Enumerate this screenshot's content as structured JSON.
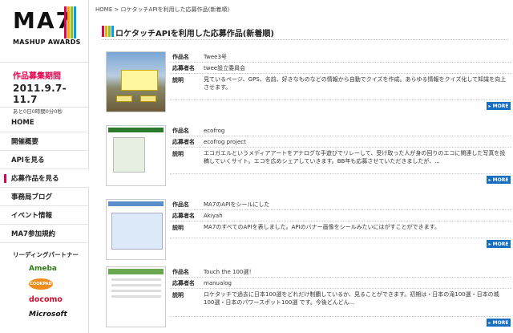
{
  "logo": {
    "text": "MA7",
    "sub": "MASHUP AWARDS"
  },
  "colors": {
    "accent": "#e5004f",
    "more_button": "#1a6ec0",
    "logo_bars": [
      "#e5004f",
      "#f7a600",
      "#8fc31f",
      "#00a0e9"
    ]
  },
  "period": {
    "title": "作品募集期間",
    "date": "2011.9.7-11.7",
    "remain": "あと0日0時間0分0秒"
  },
  "nav": {
    "items": [
      {
        "label": "HOME",
        "active": false
      },
      {
        "label": "開催概要",
        "active": false
      },
      {
        "label": "APIを見る",
        "active": false
      },
      {
        "label": "応募作品を見る",
        "active": true
      },
      {
        "label": "事務局ブログ",
        "active": false
      },
      {
        "label": "イベント情報",
        "active": false
      },
      {
        "label": "MA7参加規約",
        "active": false
      }
    ]
  },
  "partners": {
    "title": "リーディングパートナー",
    "logos": [
      "Ameba",
      "COOKPAD",
      "docomo",
      "Microsoft"
    ]
  },
  "breadcrumb": "HOME > ロケタッチAPIを利用した応募作品(新着順)",
  "heading": "ロケタッチAPIを利用した応募作品(新着順)",
  "labels": {
    "work": "作品名",
    "author": "応募者名",
    "desc": "説明",
    "more": "MORE"
  },
  "entries": [
    {
      "name": "Twee3号",
      "author": "twee設立委員会",
      "desc": "見ているページ、GPS、名前、好きなものなどの情報から自動でクイズを作成。あらゆる情報をクイズ化して知識を向上させます。"
    },
    {
      "name": "ecofrog",
      "author": "ecofrog project",
      "desc": "エコガエルというメディアアートをアナログな手遊びでリレーして、受け取った人が身の回りのエコに関連した写真を投稿していくサイト。エコを広めシェアしていきます。BB年も応募させていただきましたが、..."
    },
    {
      "name": "MA7のAPIをシールにした",
      "author": "Akiyah",
      "desc": "MA7のすべてのAPIを表しました。APIのバナー画像をシールみたいにはがすことができます。"
    },
    {
      "name": "Touch the 100選！",
      "author": "manualog",
      "desc": "ロケタッチで過去に日本100選をどれだけ制覇しているか、見ることができます。初期は・日本の滝100選・日本の城100選・日本のパワースポット100選 です。今後どんどん..."
    }
  ]
}
